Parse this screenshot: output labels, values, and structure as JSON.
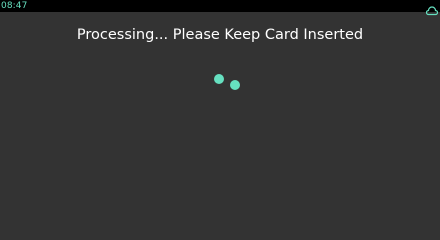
{
  "status_bar": {
    "time": "08:47",
    "icon": "cloud-icon",
    "accent_color": "#66e0c0"
  },
  "main": {
    "message": "Processing... Please Keep Card Inserted",
    "spinner": {
      "icon": "loading-dots-icon",
      "dot_color": "#66e0c0"
    }
  },
  "colors": {
    "background": "#333333",
    "status_bar_background": "#000000",
    "text": "#ffffff"
  }
}
